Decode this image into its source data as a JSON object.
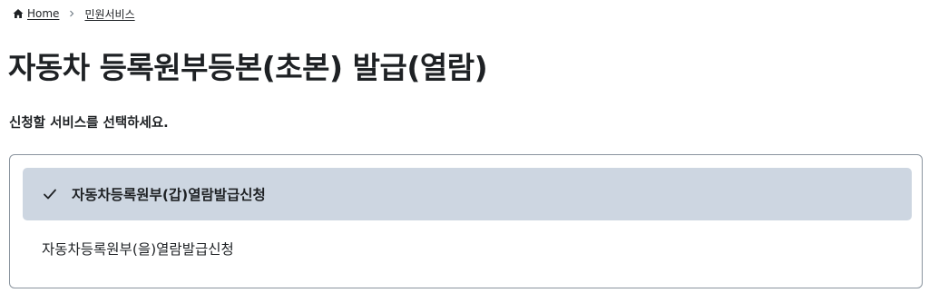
{
  "breadcrumb": {
    "home_label": "Home",
    "current_label": "민원서비스",
    "home_icon": "home-icon",
    "separator_icon": "chevron-right-icon"
  },
  "page": {
    "title": "자동차 등록원부등본(초본) 발급(열람)",
    "instruction": "신청할 서비스를 선택하세요."
  },
  "services": {
    "options": [
      {
        "label": "자동차등록원부(갑)열람발급신청",
        "selected": true,
        "icon": "check-icon"
      },
      {
        "label": "자동차등록원부(을)열람발급신청",
        "selected": false
      }
    ]
  },
  "colors": {
    "text": "#1e2124",
    "selected_background": "#cdd6e1",
    "border": "#8a949e",
    "check": "#1e2124"
  }
}
